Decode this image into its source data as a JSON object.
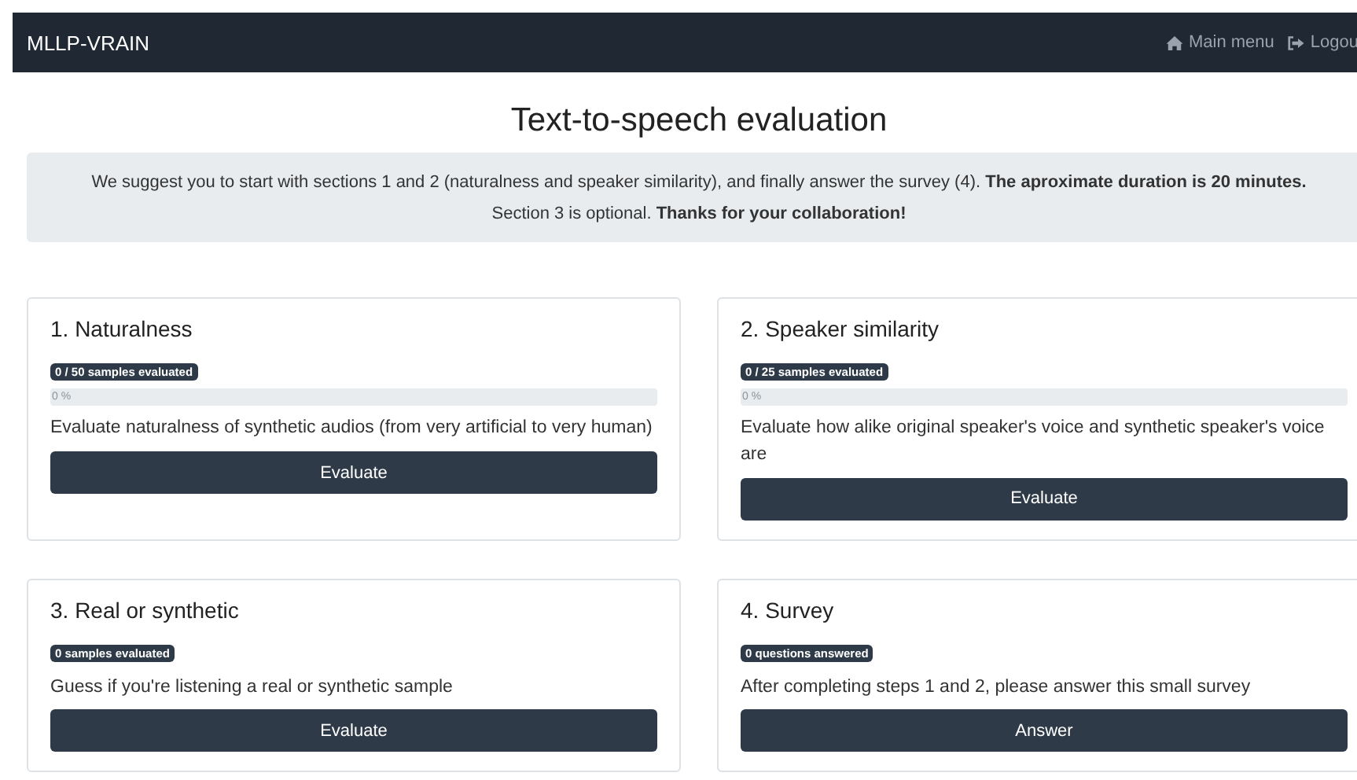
{
  "navbar": {
    "brand": "MLLP-VRAIN",
    "links": [
      {
        "label": "Main menu",
        "kind": "home"
      },
      {
        "label": "Logou",
        "kind": "logout"
      }
    ]
  },
  "title": "Text-to-speech evaluation",
  "intro": "We suggest you to start with sections 1 and 2 (naturalness and speaker similarity), and finally answer the survey (4). **The aproximate duration is 20 minutes.** Section 3 is optional. **Thanks for your collaboration!**",
  "sections": [
    {
      "title": "1. Naturalness",
      "badge": "0 / 50 samples evaluated",
      "progress": {
        "level": 0,
        "label": "0 %"
      },
      "description": "Evaluate naturalness of synthetic audios (from very artificial to very human)",
      "button": "Evaluate"
    },
    {
      "title": "2. Speaker similarity",
      "badge": "0 / 25 samples evaluated",
      "progress": {
        "level": 0,
        "label": "0 %"
      },
      "description": "Evaluate how alike original speaker's voice and synthetic speaker's voice are",
      "button": "Evaluate"
    },
    {
      "title": "3. Real or synthetic",
      "badge": "0 samples evaluated",
      "description": "Guess if you're listening a real or synthetic sample",
      "button": "Evaluate"
    },
    {
      "title": "4. Survey",
      "badge": "0 questions answered",
      "description": "After completing steps 1 and 2, please answer this small survey",
      "button": "Answer"
    }
  ]
}
